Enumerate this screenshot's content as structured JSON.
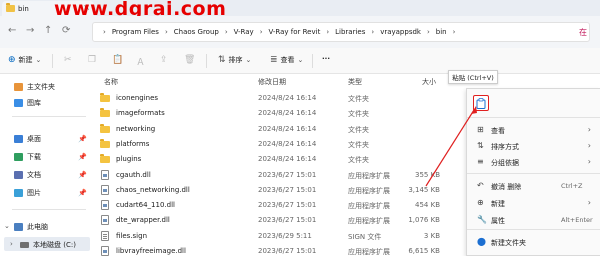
{
  "tab": {
    "title": "bin",
    "close": "×"
  },
  "watermark": "www.dgrai.com",
  "address": {
    "crumbs": [
      "Program Files",
      "Chaos Group",
      "V-Ray",
      "V-Ray for Revit",
      "Libraries",
      "vrayappsdk",
      "bin"
    ],
    "separator": "›",
    "trailing": "在"
  },
  "toolbar": {
    "new_label": "新建",
    "sort_label": "排序",
    "view_label": "查看",
    "more": "···"
  },
  "tooltip": "粘贴 (Ctrl+V)",
  "sidebar": {
    "items": [
      {
        "label": "主文件夹",
        "color": "#e8943a"
      },
      {
        "label": "图库",
        "color": "#3a8ee6"
      },
      {
        "label": "桌面",
        "color": "#3a7fd6"
      },
      {
        "label": "下载",
        "color": "#2f9e5f"
      },
      {
        "label": "文档",
        "color": "#5a6fb0"
      },
      {
        "label": "图片",
        "color": "#3aa0d8"
      },
      {
        "label": "此电脑",
        "color": "#4a7fc0"
      },
      {
        "label": "本地磁盘 (C:)",
        "color": "#707070"
      }
    ],
    "pin": "📌"
  },
  "columns": {
    "name": "名称",
    "modified": "修改日期",
    "type": "类型",
    "size": "大小"
  },
  "files": [
    {
      "icon": "folder",
      "name": "iconengines",
      "modified": "2024/8/24 16:14",
      "type": "文件夹",
      "size": ""
    },
    {
      "icon": "folder",
      "name": "imageformats",
      "modified": "2024/8/24 16:14",
      "type": "文件夹",
      "size": ""
    },
    {
      "icon": "folder",
      "name": "networking",
      "modified": "2024/8/24 16:14",
      "type": "文件夹",
      "size": ""
    },
    {
      "icon": "folder",
      "name": "platforms",
      "modified": "2024/8/24 16:14",
      "type": "文件夹",
      "size": ""
    },
    {
      "icon": "folder",
      "name": "plugins",
      "modified": "2024/8/24 16:14",
      "type": "文件夹",
      "size": ""
    },
    {
      "icon": "dll",
      "name": "cgauth.dll",
      "modified": "2023/6/27 15:01",
      "type": "应用程序扩展",
      "size": "355 KB"
    },
    {
      "icon": "dll",
      "name": "chaos_networking.dll",
      "modified": "2023/6/27 15:01",
      "type": "应用程序扩展",
      "size": "3,145 KB"
    },
    {
      "icon": "dll",
      "name": "cudart64_110.dll",
      "modified": "2023/6/27 15:01",
      "type": "应用程序扩展",
      "size": "454 KB"
    },
    {
      "icon": "dll",
      "name": "dte_wrapper.dll",
      "modified": "2023/6/27 15:01",
      "type": "应用程序扩展",
      "size": "1,076 KB"
    },
    {
      "icon": "sign",
      "name": "files.sign",
      "modified": "2023/6/29 5:11",
      "type": "SIGN 文件",
      "size": "3 KB"
    },
    {
      "icon": "dll",
      "name": "libvrayfreeimage.dll",
      "modified": "2023/6/27 15:01",
      "type": "应用程序扩展",
      "size": "6,615 KB"
    }
  ],
  "context_menu": {
    "items": [
      {
        "icon": "⊞",
        "label": "查看",
        "shortcut": "",
        "arrow": "›"
      },
      {
        "icon": "⇅",
        "label": "排序方式",
        "shortcut": "",
        "arrow": "›"
      },
      {
        "icon": "≡",
        "label": "分组依据",
        "shortcut": "",
        "arrow": "›"
      },
      {
        "icon": "↶",
        "label": "撤消 删除",
        "shortcut": "Ctrl+Z",
        "arrow": ""
      },
      {
        "icon": "⊕",
        "label": "新建",
        "shortcut": "",
        "arrow": "›"
      },
      {
        "icon": "🔧",
        "label": "属性",
        "shortcut": "Alt+Enter",
        "arrow": ""
      },
      {
        "icon": "⬤",
        "label": "新建文件夹",
        "shortcut": "",
        "arrow": ""
      }
    ]
  },
  "colors": {
    "accent": "#0067c0",
    "annotation": "#e02020"
  }
}
